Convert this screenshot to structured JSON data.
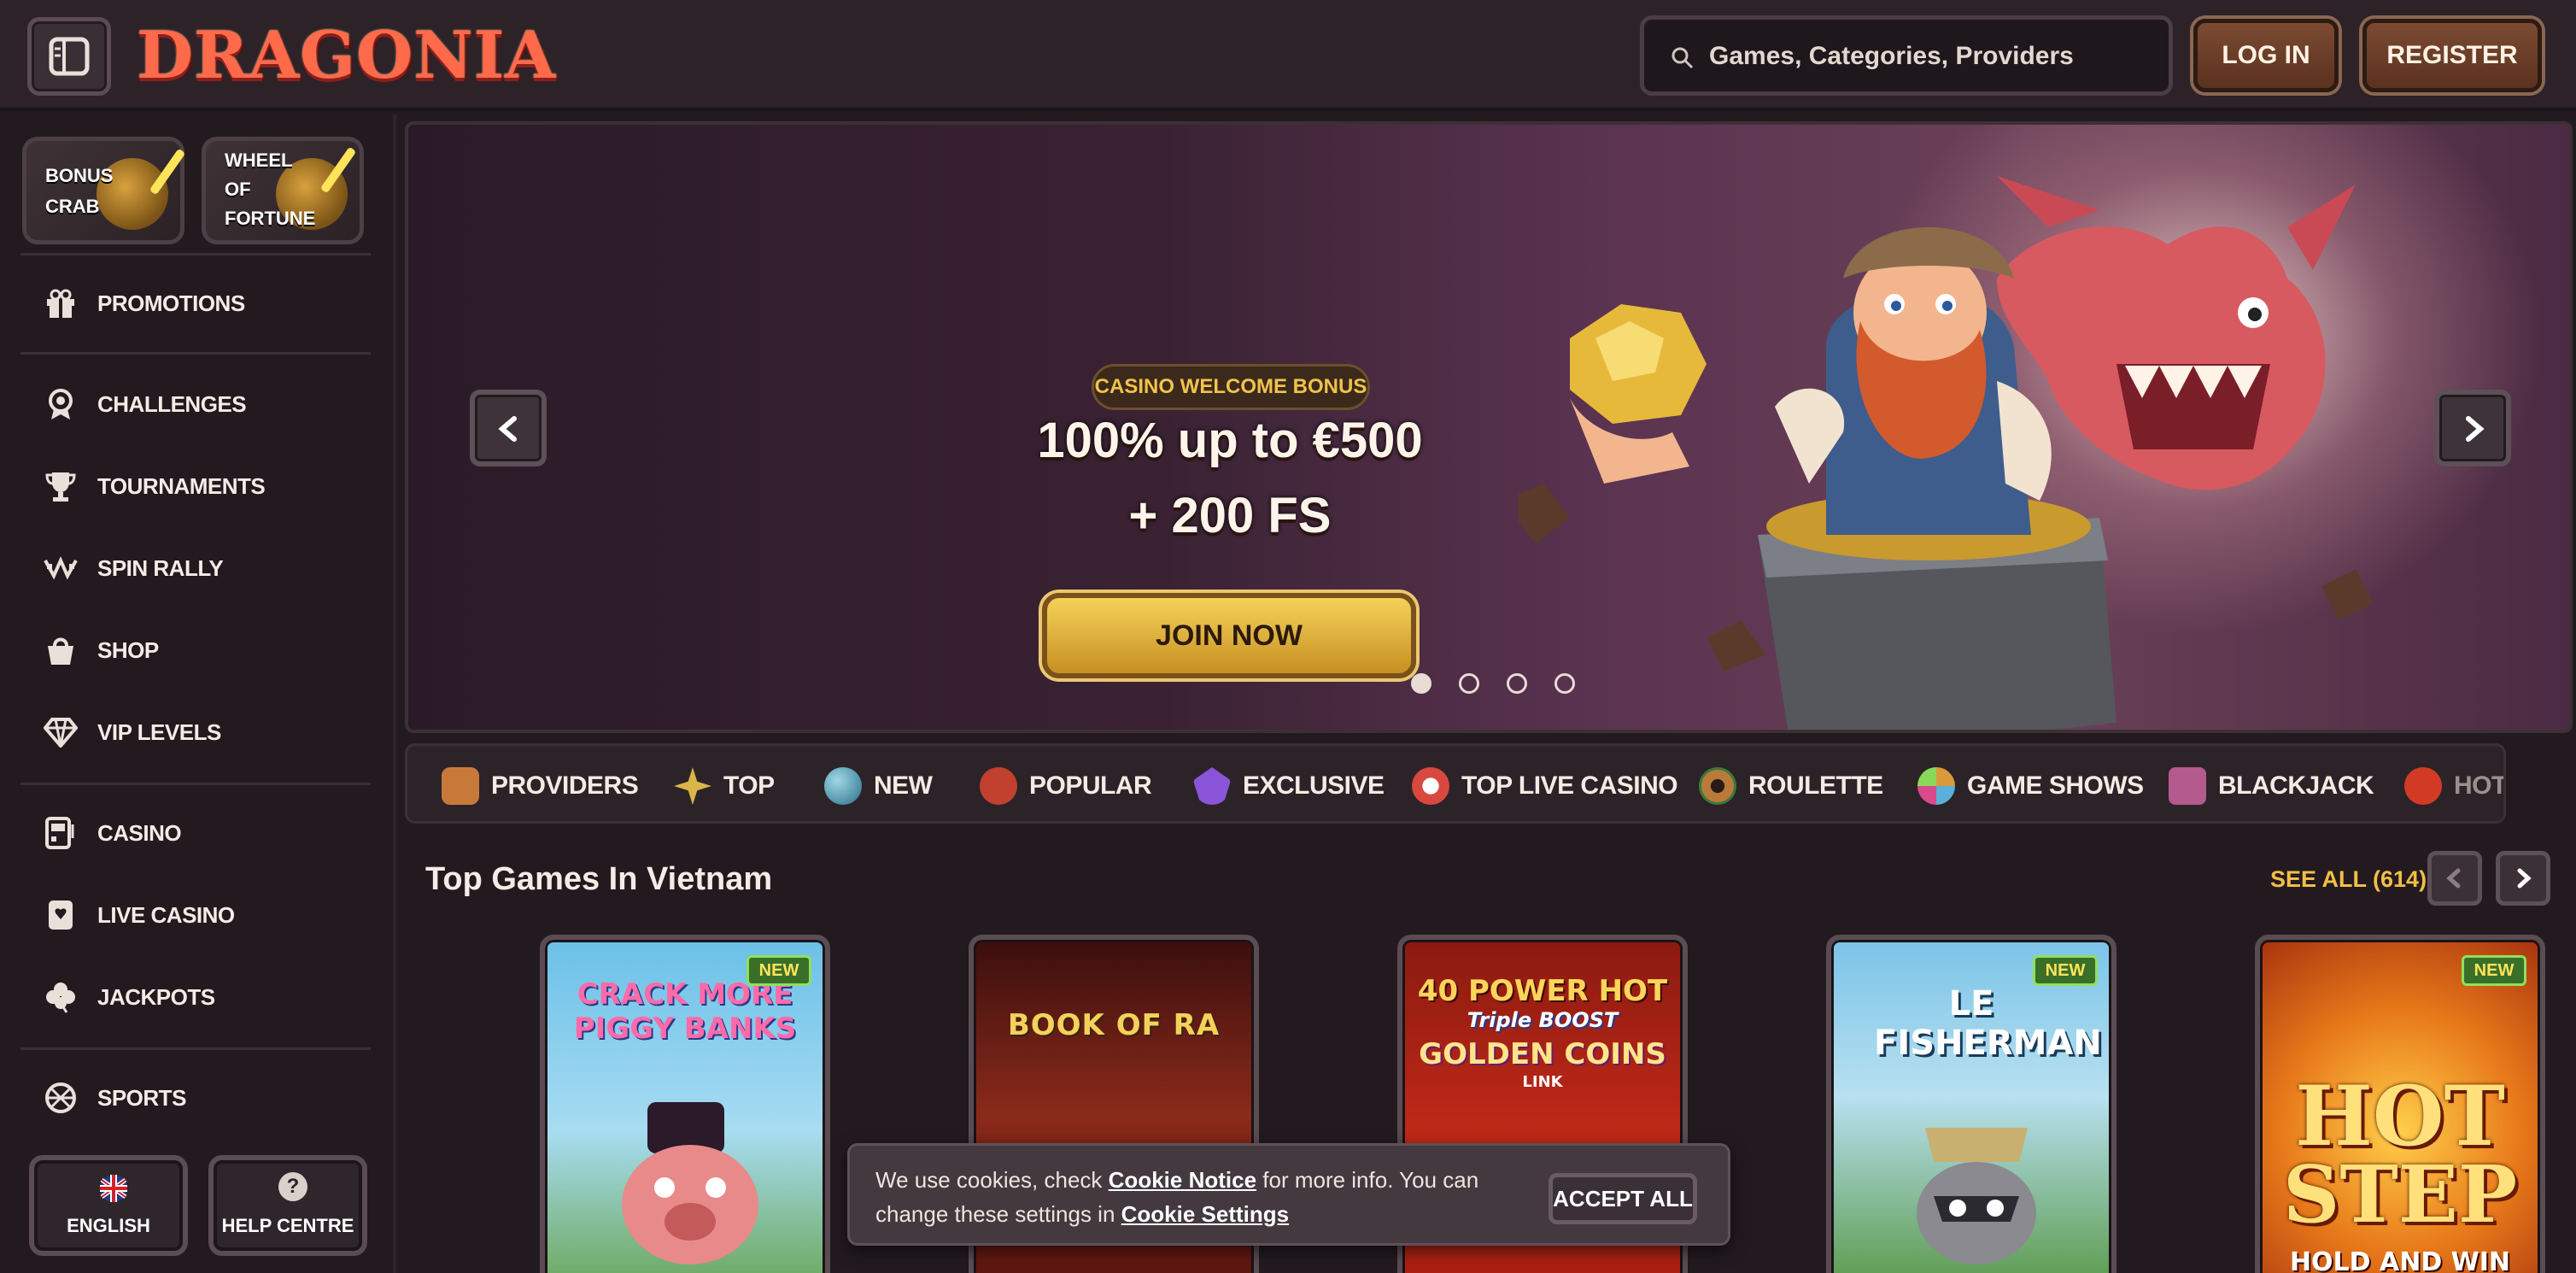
{
  "header": {
    "logo_text": "DRAGONIA",
    "search_placeholder": "Games, Categories, Providers",
    "login_label": "LOG IN",
    "register_label": "REGISTER"
  },
  "sidebar": {
    "promo_cards": [
      {
        "line1": "BONUS",
        "line2": "CRAB",
        "line3": ""
      },
      {
        "line1": "WHEEL",
        "line2": "OF",
        "line3": "FORTUNE"
      }
    ],
    "items": [
      {
        "label": "PROMOTIONS",
        "icon": "gift-icon"
      },
      {
        "label": "CHALLENGES",
        "icon": "medal-icon"
      },
      {
        "label": "TOURNAMENTS",
        "icon": "trophy-icon"
      },
      {
        "label": "SPIN RALLY",
        "icon": "race-flag-icon"
      },
      {
        "label": "SHOP",
        "icon": "shopping-bag-icon"
      },
      {
        "label": "VIP LEVELS",
        "icon": "diamond-icon"
      },
      {
        "label": "CASINO",
        "icon": "slot-machine-icon"
      },
      {
        "label": "LIVE CASINO",
        "icon": "playing-card-icon"
      },
      {
        "label": "JACKPOTS",
        "icon": "clover-icon"
      },
      {
        "label": "SPORTS",
        "icon": "ball-icon"
      }
    ],
    "language_label": "ENGLISH",
    "help_label": "HELP CENTRE",
    "help_glyph": "?"
  },
  "banner": {
    "badge": "CASINO WELCOME BONUS",
    "line1": "100% up to €500",
    "line2": "+ 200 FS",
    "cta": "JOIN NOW",
    "slides": 4,
    "active_slide": 1
  },
  "categories": [
    {
      "label": "PROVIDERS",
      "color": "#c8793a"
    },
    {
      "label": "TOP",
      "color": "#d9b54a"
    },
    {
      "label": "NEW",
      "color": "#3f8aa8"
    },
    {
      "label": "POPULAR",
      "color": "#c2402e"
    },
    {
      "label": "EXCLUSIVE",
      "color": "#8a54d8"
    },
    {
      "label": "TOP LIVE CASINO",
      "color": "#d8483f"
    },
    {
      "label": "ROULETTE",
      "color": "#b97a3a"
    },
    {
      "label": "GAME SHOWS",
      "color": "#d99a3b"
    },
    {
      "label": "BLACKJACK",
      "color": "#b45a8c"
    },
    {
      "label": "HOT",
      "color": "#d33a25"
    }
  ],
  "top_games": {
    "title": "Top Games In Vietnam",
    "see_all": "SEE ALL (614)",
    "cards": [
      {
        "title": "CRACK MORE PIGGY BANKS",
        "new": "NEW"
      },
      {
        "title": "BOOK OF RA",
        "new": ""
      },
      {
        "title_top": "40 POWER HOT",
        "title_mid": "Triple BOOST",
        "title_bottom": "GOLDEN COINS",
        "title_link": "LINK",
        "new": ""
      },
      {
        "title": "LE FISHERMAN",
        "new": "NEW"
      },
      {
        "title_top": "HOT",
        "title_mid": "STEP",
        "title_bottom": "HOLD AND WIN",
        "new": "NEW"
      }
    ]
  },
  "cookie": {
    "t1": "We use cookies, check ",
    "link1": "Cookie Notice",
    "t2": " for more info. You can change these settings in ",
    "link2": "Cookie Settings",
    "accept": "ACCEPT ALL"
  },
  "colors": {
    "background": "#221a1f",
    "accent_gold": "#f2be46",
    "logo_red": "#ff6a4a"
  }
}
